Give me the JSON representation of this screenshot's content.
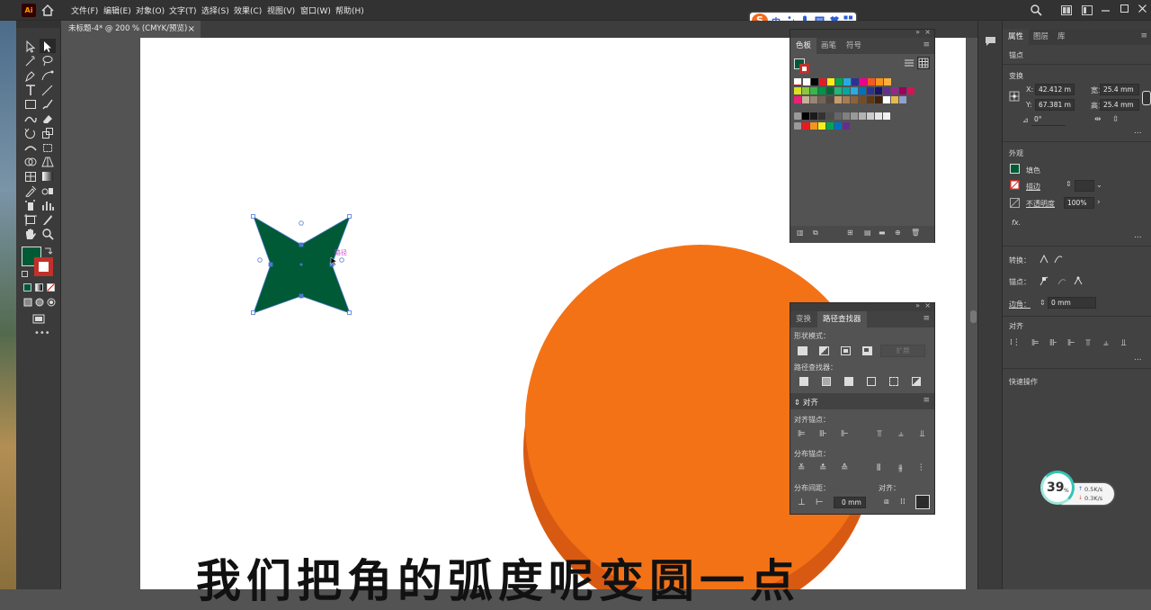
{
  "menubar": {
    "logo": "Ai",
    "items": [
      "文件(F)",
      "编辑(E)",
      "对象(O)",
      "文字(T)",
      "选择(S)",
      "效果(C)",
      "视图(V)",
      "窗口(W)",
      "帮助(H)"
    ]
  },
  "document_tab": {
    "title": "未标题-4* @ 200 % (CMYK/预览)",
    "close": "×"
  },
  "ime": {
    "mode": "中"
  },
  "canvas": {
    "hover_label": "路径"
  },
  "swatches_panel": {
    "tabs": [
      "色板",
      "画笔",
      "符号"
    ],
    "colors_row1": [
      "#ffffff",
      "#000000",
      "#e31c23",
      "#f7ed1b",
      "#02a650",
      "#28aae1",
      "#2e3192",
      "#ec008c",
      "#f15a24",
      "#f7931e",
      "#fbb03b"
    ],
    "colors_row2": [
      "#d9e021",
      "#8cc63f",
      "#39b54a",
      "#009245",
      "#006837",
      "#22b573",
      "#00a99d",
      "#29abe2",
      "#0071bc",
      "#2e3192",
      "#1b1464",
      "#662d91",
      "#93278f",
      "#9e005d",
      "#d4145a"
    ],
    "colors_row3": [
      "#ed1e79",
      "#c7b299",
      "#998675",
      "#736357",
      "#534741",
      "#c69c6d",
      "#a67c52",
      "#8c6239",
      "#754c24",
      "#603813",
      "#42210b",
      "#ffffff",
      "#e6b94c",
      "#8fa3c9"
    ],
    "colors_row4": [
      "#000000",
      "#1a1a1a",
      "#333333",
      "#4d4d4d",
      "#666666",
      "#808080",
      "#999999",
      "#b3b3b3",
      "#cccccc",
      "#e6e6e6",
      "#f2f2f2"
    ],
    "colors_row5": [
      "#e31c23",
      "#f7931e",
      "#f7ed1b",
      "#02a650",
      "#0071bc",
      "#662d91"
    ]
  },
  "pathfinder_panel": {
    "tabs": [
      "变换",
      "路径查找器"
    ],
    "shape_modes_label": "形状模式：",
    "expand_label": "扩展",
    "pathfinders_label": "路径查找器："
  },
  "align_panel": {
    "title": "对齐",
    "align_objects_label": "对齐锚点：",
    "distribute_objects_label": "分布锚点：",
    "distribute_spacing_label": "分布间距：",
    "align_to_label": "对齐：",
    "spacing_value": "0 mm"
  },
  "properties_panel": {
    "tabs": [
      "属性",
      "图层",
      "库"
    ],
    "selection_type": "锚点",
    "transform_title": "变换",
    "x_label": "X:",
    "x_value": "42.412 m",
    "y_label": "Y:",
    "y_value": "67.381 m",
    "w_label": "宽：",
    "w_value": "25.4 mm",
    "h_label": "高：",
    "h_value": "25.4 mm",
    "angle_value": "0°",
    "appearance_title": "外观",
    "fill_label": "填色",
    "stroke_label": "描边",
    "opacity_label": "不透明度",
    "opacity_value": "100%",
    "fx_label": "fx.",
    "convert_label": "转换：",
    "anchor_label": "锚点：",
    "corner_label": "边角：",
    "corner_value": "0 mm",
    "align_title": "对齐",
    "quick_actions_title": "快速操作",
    "more": "..."
  },
  "netmon": {
    "percent": "39",
    "percent_unit": "%",
    "up": "0.5K/s",
    "down": "0.3K/s"
  },
  "subtitle": "我们把角的弧度呢变圆一点",
  "colors": {
    "star_fill": "#005a36",
    "circle": "#f47216",
    "circle_shadow": "#d85a12",
    "accent_ime": "#f46a1e"
  }
}
